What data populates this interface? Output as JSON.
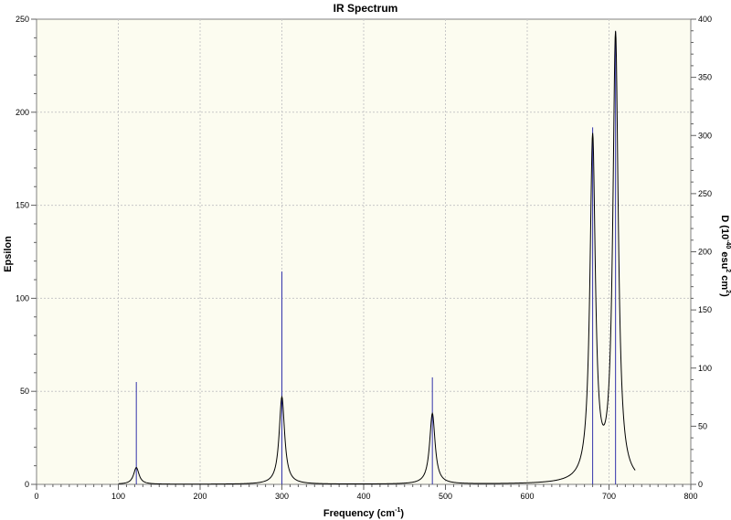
{
  "chart_data": {
    "type": "line",
    "title": "IR Spectrum",
    "xlabel": "Frequency (cm-1)",
    "xlabel_parts": {
      "main": "Frequency (cm",
      "sup": "-1",
      "close": ")"
    },
    "ylabel_left": "Epsilon",
    "ylabel_right": "D (10-40 esu2 cm2)",
    "ylabel_right_parts": {
      "a": "D (10",
      "sup1": "-40",
      "b": " esu",
      "sup2": "2",
      "c": " cm",
      "sup3": "2",
      "d": ")"
    },
    "xlim": [
      0,
      800
    ],
    "ylim_left": [
      0,
      250
    ],
    "ylim_right": [
      0,
      400
    ],
    "x_ticks": [
      0,
      100,
      200,
      300,
      400,
      500,
      600,
      700,
      800
    ],
    "y_ticks_left": [
      0,
      50,
      100,
      150,
      200,
      250
    ],
    "y_ticks_right": [
      0,
      50,
      100,
      150,
      200,
      250,
      300,
      350,
      400
    ],
    "grid": true,
    "line_range": [
      100,
      732
    ],
    "series": [
      {
        "kind": "spectrum",
        "axis": "left",
        "peaks": [
          {
            "x": 122,
            "y": 9
          },
          {
            "x": 300,
            "y": 47
          },
          {
            "x": 484,
            "y": 38
          },
          {
            "x": 680,
            "y": 184
          },
          {
            "x": 708,
            "y": 240
          }
        ]
      },
      {
        "kind": "stick",
        "axis": "right",
        "x": [
          122,
          300,
          484,
          680,
          708
        ],
        "y": [
          88,
          183,
          92,
          307,
          389
        ]
      }
    ],
    "colors": {
      "plot_bg": "#fcfcf0",
      "grid": "#c8c8c8",
      "spectrum": "#000000",
      "sticks": "#3333aa",
      "axis": "#606060"
    }
  }
}
